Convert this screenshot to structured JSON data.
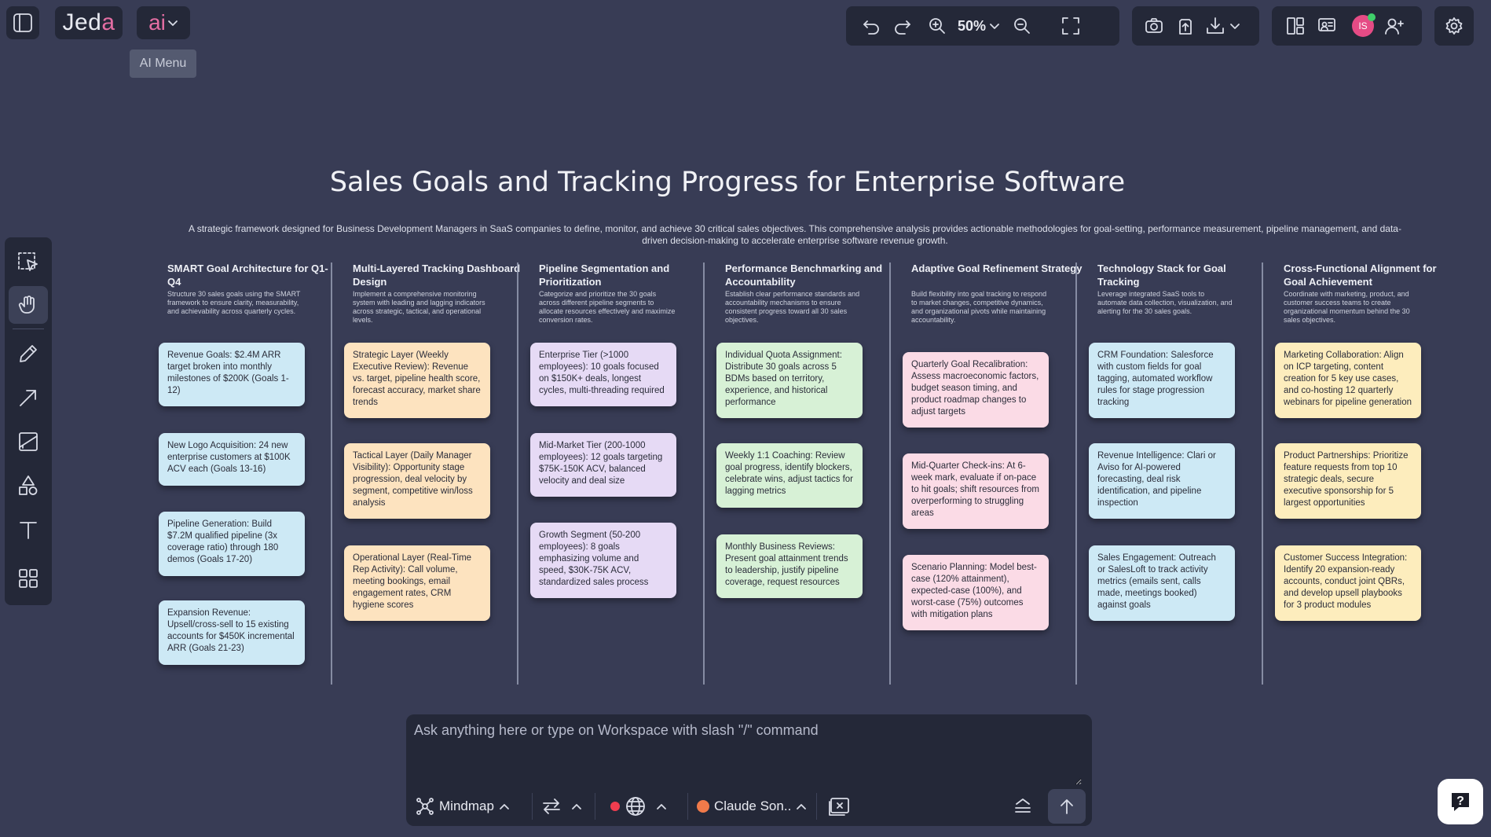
{
  "app": {
    "logo_prefix": "Jed",
    "logo_accent": "a",
    "ai_button": "ai",
    "ai_tooltip": "AI Menu"
  },
  "toolbar": {
    "zoom": "50%"
  },
  "user": {
    "initials": "IS"
  },
  "canvas": {
    "title": "Sales Goals and Tracking Progress for Enterprise Software",
    "subtitle": "A strategic framework designed for Business Development Managers in SaaS companies to define, monitor, and achieve 30 critical sales objectives. This comprehensive analysis provides actionable methodologies for goal-setting, performance measurement, pipeline management, and data-driven decision-making to accelerate enterprise software revenue growth.",
    "columns": [
      {
        "heading": "SMART Goal Architecture for Q1-Q4",
        "description": "Structure 30 sales goals using the SMART framework to ensure clarity, measurability, and achievability across quarterly cycles.",
        "color": "#cde9f5",
        "cards": [
          "Revenue Goals: $2.4M ARR target broken into monthly milestones of $200K (Goals 1-12)",
          "New Logo Acquisition: 24 new enterprise customers at $100K ACV each (Goals 13-16)",
          "Pipeline Generation: Build $7.2M qualified pipeline (3x coverage ratio) through 180 demos (Goals 17-20)",
          "Expansion Revenue: Upsell/cross-sell to 15 existing accounts for $450K incremental ARR (Goals 21-23)"
        ]
      },
      {
        "heading": "Multi-Layered Tracking Dashboard Design",
        "description": "Implement a comprehensive monitoring system with leading and lagging indicators across strategic, tactical, and operational levels.",
        "color": "#fde3bf",
        "cards": [
          "Strategic Layer (Weekly Executive Review): Revenue vs. target, pipeline health score, forecast accuracy, market share trends",
          "Tactical Layer (Daily Manager Visibility): Opportunity stage progression, deal velocity by segment, competitive win/loss analysis",
          "Operational Layer (Real-Time Rep Activity): Call volume, meeting bookings, email engagement rates, CRM hygiene scores"
        ]
      },
      {
        "heading": "Pipeline Segmentation and Prioritization",
        "description": "Categorize and prioritize the 30 goals across different pipeline segments to allocate resources effectively and maximize conversion rates.",
        "color": "#e6daf5",
        "cards": [
          "Enterprise Tier (>1000 employees): 10 goals focused on $150K+ deals, longest cycles, multi-threading required",
          "Mid-Market Tier (200-1000 employees): 12 goals targeting $75K-150K ACV, balanced velocity and deal size",
          "Growth Segment (50-200 employees): 8 goals emphasizing volume and speed, $30K-75K ACV, standardized sales process"
        ]
      },
      {
        "heading": "Performance Benchmarking and Accountability",
        "description": "Establish clear performance standards and accountability mechanisms to ensure consistent progress toward all 30 sales objectives.",
        "color": "#d7f1d6",
        "cards": [
          "Individual Quota Assignment: Distribute 30 goals across 5 BDMs based on territory, experience, and historical performance",
          "Weekly 1:1 Coaching: Review goal progress, identify blockers, celebrate wins, adjust tactics for lagging metrics",
          "Monthly Business Reviews: Present goal attainment trends to leadership, justify pipeline coverage, request resources"
        ]
      },
      {
        "heading": "Adaptive Goal Refinement Strategy",
        "description": "Build flexibility into goal tracking to respond to market changes, competitive dynamics, and organizational pivots while maintaining accountability.",
        "color": "#fbdbe6",
        "cards": [
          "Quarterly Goal Recalibration: Assess macroeconomic factors, budget season timing, and product roadmap changes to adjust targets",
          "Mid-Quarter Check-ins: At 6-week mark, evaluate if on-pace to hit goals; shift resources from overperforming to struggling areas",
          "Scenario Planning: Model best-case (120% attainment), expected-case (100%), and worst-case (75%) outcomes with mitigation plans"
        ]
      },
      {
        "heading": "Technology Stack for Goal Tracking",
        "description": "Leverage integrated SaaS tools to automate data collection, visualization, and alerting for the 30 sales goals.",
        "color": "#cde9f5",
        "cards": [
          "CRM Foundation: Salesforce with custom fields for goal tagging, automated workflow rules for stage progression tracking",
          "Revenue Intelligence: Clari or Aviso for AI-powered forecasting, deal risk identification, and pipeline inspection",
          "Sales Engagement: Outreach or SalesLoft to track activity metrics (emails sent, calls made, meetings booked) against goals"
        ]
      },
      {
        "heading": "Cross-Functional Alignment for Goal Achievement",
        "description": "Coordinate with marketing, product, and customer success teams to create organizational momentum behind the 30 sales objectives.",
        "color": "#fdedbd",
        "cards": [
          "Marketing Collaboration: Align on ICP targeting, content creation for 5 key use cases, and co-hosting 12 quarterly webinars for pipeline generation",
          "Product Partnerships: Prioritize feature requests from top 10 strategic deals, secure executive sponsorship for 5 largest opportunities",
          "Customer Success Integration: Identify 20 expansion-ready accounts, conduct joint QBRs, and develop upsell playbooks for 3 product modules"
        ]
      }
    ]
  },
  "chat": {
    "placeholder": "Ask anything here or type on Workspace with slash \"/\" command",
    "mode_label": "Mindmap",
    "model_label": "Claude Son.."
  }
}
